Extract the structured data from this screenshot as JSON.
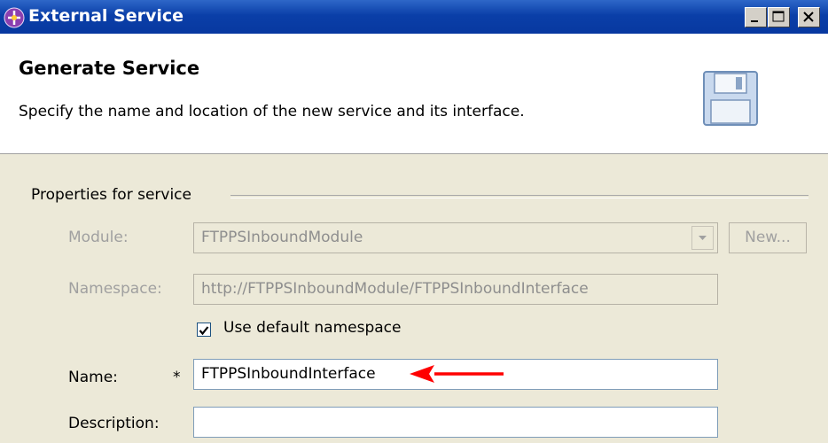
{
  "window": {
    "title": "External Service",
    "controls": {
      "minimize": "minimize",
      "maximize": "maximize",
      "close": "close"
    }
  },
  "header": {
    "title": "Generate Service",
    "description": "Specify the name and location of the new service and its interface."
  },
  "group": {
    "title": "Properties for service"
  },
  "form": {
    "module_label": "Module:",
    "module_value": "FTPPSInboundModule",
    "new_button": "New...",
    "namespace_label": "Namespace:",
    "namespace_value": "http://FTPPSInboundModule/FTPPSInboundInterface",
    "use_default_namespace_label": "Use default namespace",
    "use_default_namespace_checked": true,
    "name_label": "Name:",
    "required_marker": "*",
    "name_value": "FTPPSInboundInterface",
    "description_label": "Description:",
    "description_value": ""
  },
  "colors": {
    "titlebar": "#0a3fa8",
    "body_bg": "#ece9d8",
    "annotation_arrow": "#ff0000"
  },
  "icons": {
    "app": "wiring-icon",
    "banner": "floppy-disk-icon",
    "annotation": "red-arrow-left"
  }
}
